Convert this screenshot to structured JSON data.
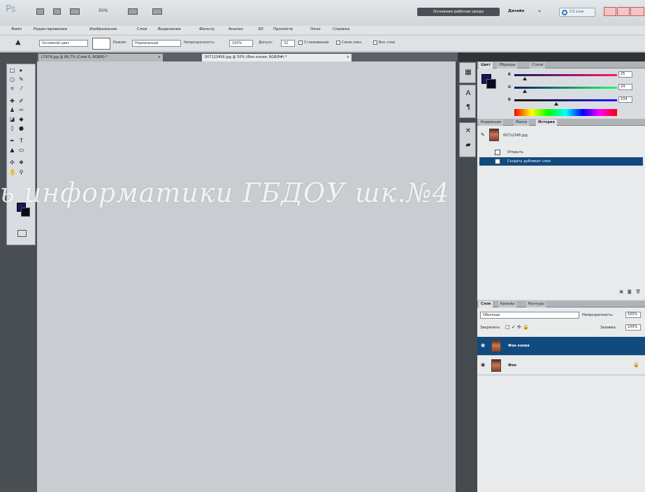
{
  "app": {
    "logo": "Ps",
    "zoom": "50%",
    "workspace_active": "Основная рабочая среда",
    "workspace_design": "Дизайн",
    "more": "»",
    "cs_live": "CS Live"
  },
  "menu": [
    "Файл",
    "Редактирование",
    "Изображение",
    "Слои",
    "Выделение",
    "Фильтр",
    "Анализ",
    "3D",
    "Просмотр",
    "Окно",
    "Справка"
  ],
  "options": {
    "source_select": "Основной цвет",
    "mode_label": "Режим:",
    "mode_value": "Нормальный",
    "opacity_label": "Непрозрачность:",
    "opacity_value": "100%",
    "tolerance_label": "Допуск:",
    "tolerance_value": "32",
    "antialias_label": "Сглаживание",
    "contiguous_label": "Смеж.пикс",
    "all_layers_label": "Все слои"
  },
  "documents": {
    "tab1": "L7974.jpg @ 66,7% (Слой 0, RGB/8) *",
    "tab2": "007123456.jpg @ 50% (Фон копия, RGB/8#) *",
    "close": "×"
  },
  "color_panel": {
    "tabs": [
      "Цвет",
      "Образцы",
      "Стили"
    ],
    "r_label": "R",
    "g_label": "G",
    "b_label": "B",
    "r_value": "25",
    "g_value": "24",
    "b_value": "104",
    "r_fraction": 0.1,
    "g_fraction": 0.1,
    "b_fraction": 0.41,
    "fg_color": "#1a1560",
    "bg_color": "#0c0a1a"
  },
  "history_panel": {
    "tabs": [
      "Коррекция",
      "Маски",
      "История"
    ],
    "snapshot_name": "00712345.jpg",
    "items": [
      "Открыть",
      "Создать дубликат слоя"
    ]
  },
  "layers_panel": {
    "tabs": [
      "Слои",
      "Каналы",
      "Контуры"
    ],
    "blend_mode": "Обычные",
    "opacity_label": "Непрозрачность:",
    "opacity_value": "100%",
    "lock_label": "Закрепить:",
    "fill_label": "Заливка:",
    "fill_value": "100%",
    "layers": [
      "Фон копия",
      "Фон"
    ]
  },
  "watermark": "ь информатики ГБДОУ шк.№4",
  "colors": {
    "selection": "#114a7e",
    "workspace_button": "#4a4f55",
    "canvas": "#c9cdd1"
  }
}
